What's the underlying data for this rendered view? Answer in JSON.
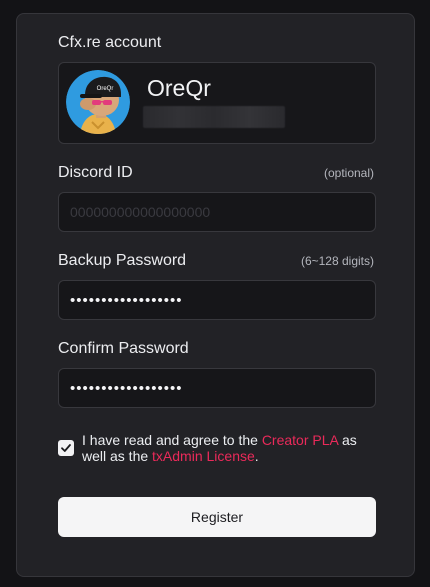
{
  "account": {
    "label": "Cfx.re account",
    "username": "OreQr",
    "avatar_cap_text": "OreQr"
  },
  "discord": {
    "label": "Discord ID",
    "hint": "(optional)",
    "placeholder": "000000000000000000",
    "value": ""
  },
  "backup_password": {
    "label": "Backup Password",
    "hint": "(6~128 digits)",
    "value": "••••••••••••••••••"
  },
  "confirm_password": {
    "label": "Confirm Password",
    "value": "••••••••••••••••••"
  },
  "agreement": {
    "checked": true,
    "text_before": "I have read and agree to the ",
    "link1": "Creator PLA",
    "text_middle": " as well as the ",
    "link2": "txAdmin License",
    "text_after": "."
  },
  "register_label": "Register",
  "colors": {
    "link": "#ea2a5a",
    "avatar_bg": "#2f9be0"
  }
}
